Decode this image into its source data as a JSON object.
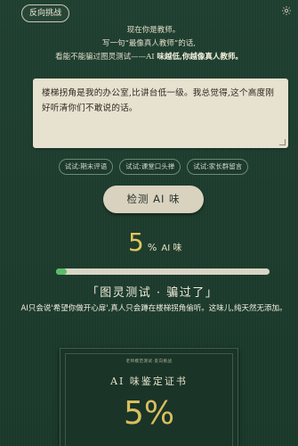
{
  "header": {
    "back_challenge": "反向挑战",
    "settings_icon": "gear-icon"
  },
  "intro": {
    "line1": "现在你是教师。",
    "line2": "写一句“最像真人教师”的话,",
    "line3_a": "看能不能骗过图灵测试——AI",
    "line3_b": "味越低,你越像真人教师。"
  },
  "input": {
    "value": "楼梯拐角是我的办公室,比讲台低一级。我总觉得,这个高度刚好听清你们不敢说的话。"
  },
  "chips": [
    "试试:期末评语",
    "试试:课堂口头禅",
    "试试:家长群留言"
  ],
  "detect_button": "检测 AI 味",
  "score": {
    "value": "5",
    "unit": "%",
    "label": "AI 味"
  },
  "progress": {
    "percent": 5
  },
  "verdict": "「图灵测试 · 骗过了」",
  "comment": "AI只会说'希望你做开心扉',真人只会蹲在楼梯拐角偷听。这味儿,纯天然无添加。",
  "certificate": {
    "header": "老师模范测试·反向挑战",
    "title": "AI 味鉴定证书",
    "value": "5%"
  },
  "colors": {
    "background": "#1e3d2e",
    "accent": "#e2c65a",
    "progress": "#5cbb6a"
  }
}
